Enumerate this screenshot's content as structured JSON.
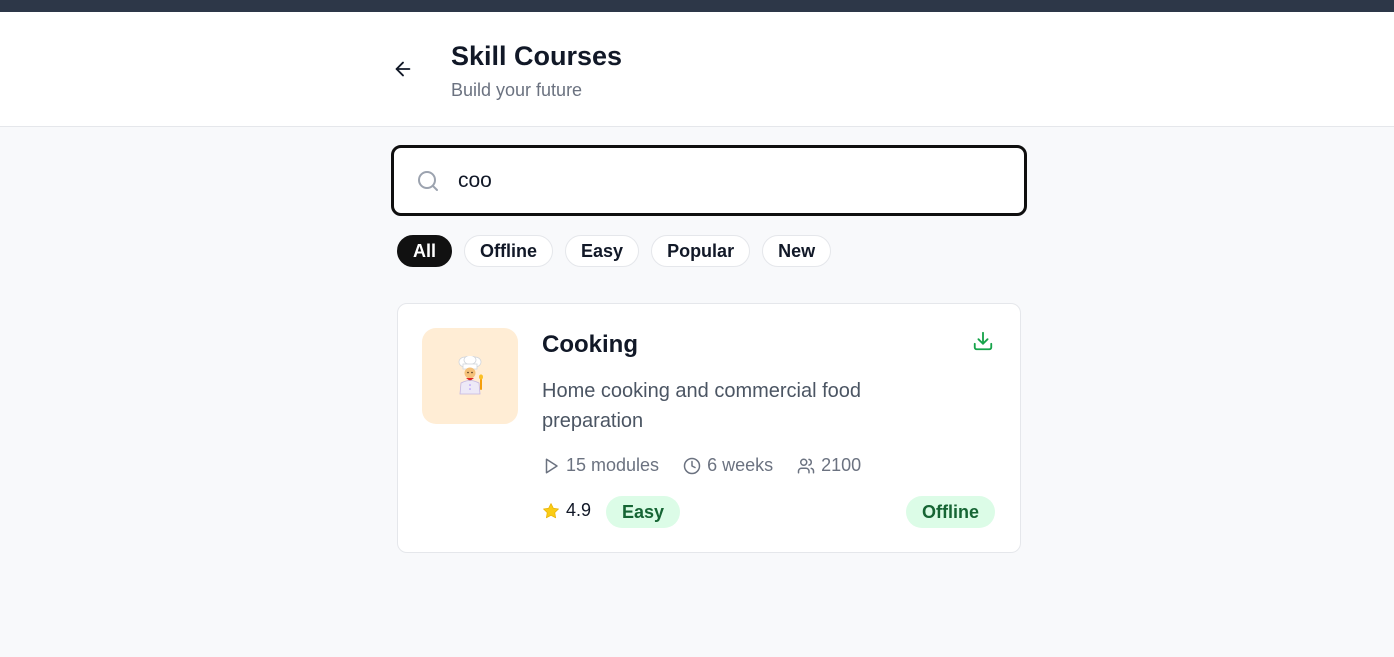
{
  "header": {
    "title": "Skill Courses",
    "subtitle": "Build your future"
  },
  "search": {
    "value": "coo",
    "placeholder": ""
  },
  "filters": [
    {
      "label": "All",
      "active": true
    },
    {
      "label": "Offline",
      "active": false
    },
    {
      "label": "Easy",
      "active": false
    },
    {
      "label": "Popular",
      "active": false
    },
    {
      "label": "New",
      "active": false
    }
  ],
  "courses": [
    {
      "title": "Cooking",
      "thumbnail_icon": "chef-icon",
      "description": "Home cooking and commercial food preparation",
      "modules": "15 modules",
      "duration": "6 weeks",
      "learners": "2100",
      "rating": "4.9",
      "level": "Easy",
      "mode": "Offline"
    }
  ],
  "colors": {
    "accent_green": "#16a34a",
    "badge_bg": "#dcfce7",
    "badge_text": "#166534",
    "star": "#facc15",
    "thumb_bg": "#ffedd5"
  }
}
